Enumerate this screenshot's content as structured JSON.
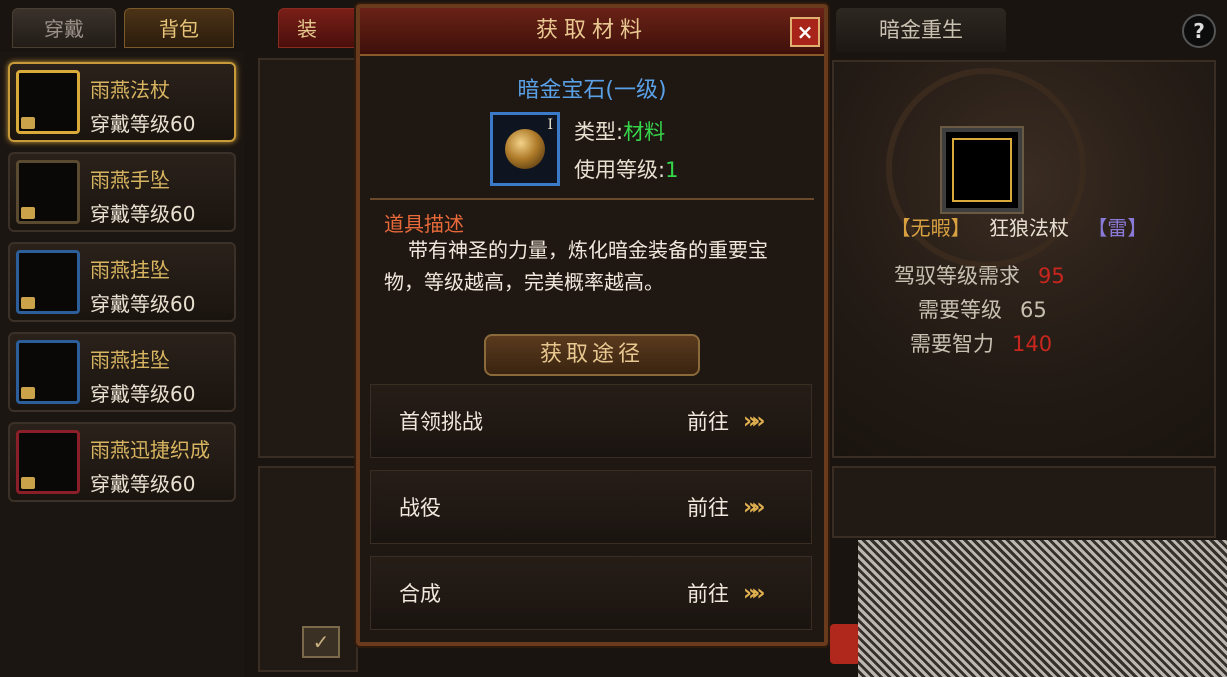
{
  "tabs": {
    "wear": "穿戴",
    "bag": "背包",
    "equip_partial": "装备",
    "dark_gold_rebirth": "暗金重生"
  },
  "help_icon": "?",
  "items": [
    {
      "name": "雨燕法杖",
      "level": "穿戴等级60",
      "frame": "gold",
      "selected": true
    },
    {
      "name": "雨燕手坠",
      "level": "穿戴等级60",
      "frame": "plain",
      "selected": false
    },
    {
      "name": "雨燕挂坠",
      "level": "穿戴等级60",
      "frame": "blue",
      "selected": false
    },
    {
      "name": "雨燕挂坠",
      "level": "穿戴等级60",
      "frame": "blue",
      "selected": false
    },
    {
      "name": "雨燕迅捷织成",
      "level": "穿戴等级60",
      "frame": "red",
      "selected": false
    }
  ],
  "dialog": {
    "title": "获取材料",
    "close": "×",
    "item_name": "暗金宝石(一级)",
    "icon_level": "I",
    "type_label": "类型:",
    "type_value": "材料",
    "use_level_label": "使用等级:",
    "use_level_value": "1",
    "desc_head": "道具描述",
    "desc_text": "带有神圣的力量，炼化暗金装备的重要宝物，等级越高，完美概率越高。",
    "route_banner": "获取途径",
    "routes": [
      {
        "name": "首领挑战",
        "go": "前往",
        "arrow": "»»"
      },
      {
        "name": "战役",
        "go": "前往",
        "arrow": "»»"
      },
      {
        "name": "合成",
        "go": "前往",
        "arrow": "»»"
      }
    ]
  },
  "right": {
    "tag_flawless": "【无暇】",
    "item_name": "狂狼法杖",
    "tag_thunder": "【雷】",
    "stats": [
      {
        "label": "驾驭等级需求",
        "value": "95",
        "color": "#c8261e"
      },
      {
        "label": "需要等级",
        "value": "65",
        "color": "#c8c0b0"
      },
      {
        "label": "需要智力",
        "value": "140",
        "color": "#c8261e"
      }
    ]
  },
  "checkbox_mark": "✓",
  "colors": {
    "gold": "#d8b560",
    "blue_title": "#5aa0e6",
    "green_value": "#36d64a",
    "desc_head": "#e86a3a",
    "tag_gold": "#d8a040",
    "tag_purple": "#8a7ad8"
  }
}
